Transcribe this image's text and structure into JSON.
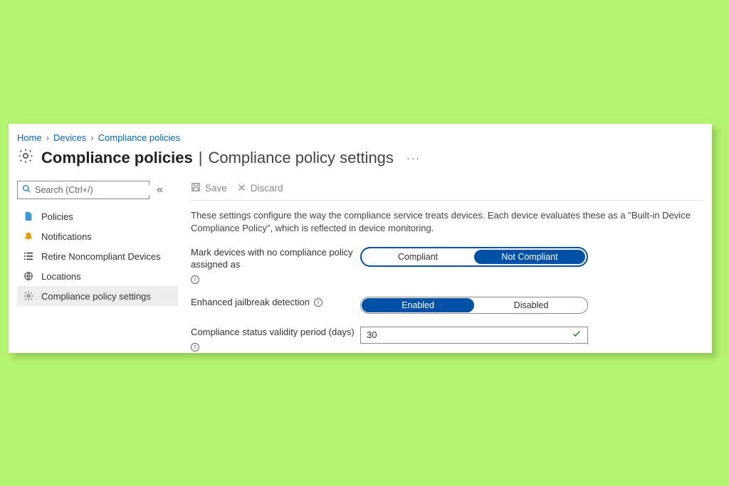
{
  "breadcrumbs": [
    "Home",
    "Devices",
    "Compliance policies"
  ],
  "title": {
    "bold": "Compliance policies",
    "rest": "Compliance policy settings"
  },
  "search": {
    "placeholder": "Search (Ctrl+/)"
  },
  "sidebar": {
    "items": [
      {
        "label": "Policies"
      },
      {
        "label": "Notifications"
      },
      {
        "label": "Retire Noncompliant Devices"
      },
      {
        "label": "Locations"
      },
      {
        "label": "Compliance policy settings"
      }
    ]
  },
  "toolbar": {
    "save": "Save",
    "discard": "Discard"
  },
  "description": "These settings configure the way the compliance service treats devices. Each device evaluates these as a \"Built-in Device Compliance Policy\", which is reflected in device monitoring.",
  "settings": {
    "mark_label": "Mark devices with no compliance policy assigned as",
    "mark_options": {
      "left": "Compliant",
      "right": "Not Compliant"
    },
    "jailbreak_label": "Enhanced jailbreak detection",
    "jailbreak_options": {
      "left": "Enabled",
      "right": "Disabled"
    },
    "validity_label": "Compliance status validity period (days)",
    "validity_value": "30"
  }
}
